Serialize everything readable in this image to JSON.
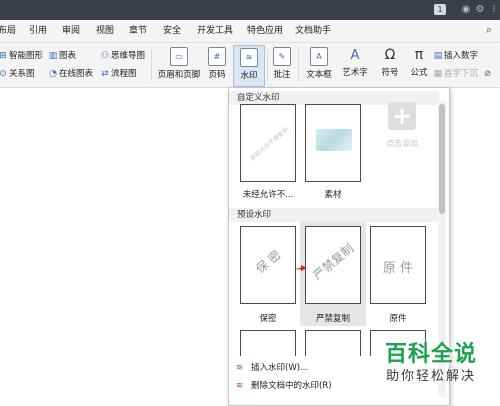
{
  "titlebar": {
    "badge": "1"
  },
  "menu": {
    "tabs": [
      "布局",
      "引用",
      "审阅",
      "视图",
      "章节",
      "安全",
      "开发工具",
      "特色应用",
      "文档助手"
    ]
  },
  "ribbon": {
    "small": {
      "smart_shape": "智能图形",
      "chart": "图表",
      "mind_map": "思维导图",
      "relation_chart": "关系图",
      "online_chart": "在线图表",
      "flowchart": "流程图"
    },
    "big": {
      "header_footer": "页眉和页脚",
      "page_number": "页码",
      "watermark": "水印",
      "comment": "批注",
      "textbox": "文本框",
      "art_text": "艺术字",
      "symbol": "符号",
      "formula": "公式"
    },
    "right": {
      "insert_number": "插入数字",
      "first_drop": "首字下沉"
    }
  },
  "panel": {
    "custom_header": "自定义水印",
    "preset_header": "预设水印",
    "custom": [
      {
        "label": "未经允许不...",
        "mark": "未经允许不得复制"
      },
      {
        "label": "素材",
        "mark": ""
      }
    ],
    "add_label": "点击添加",
    "preset": [
      {
        "label": "保密",
        "mark": "保 密"
      },
      {
        "label": "严禁复制",
        "mark": "严禁复制"
      },
      {
        "label": "原件",
        "mark": "原 件"
      }
    ],
    "actions": {
      "insert": "插入水印(W)...",
      "delete": "删除文档中的水印(R)"
    }
  },
  "brand": {
    "top": "百科全说",
    "bottom": "助你轻松解决"
  },
  "colors": {
    "titlebar": "#3b3f4a",
    "ribbon": "#f4f4f4",
    "watermark_active": "#dbe6f3",
    "brand_green": "#19a34a",
    "arrow_red": "#d9261c"
  }
}
